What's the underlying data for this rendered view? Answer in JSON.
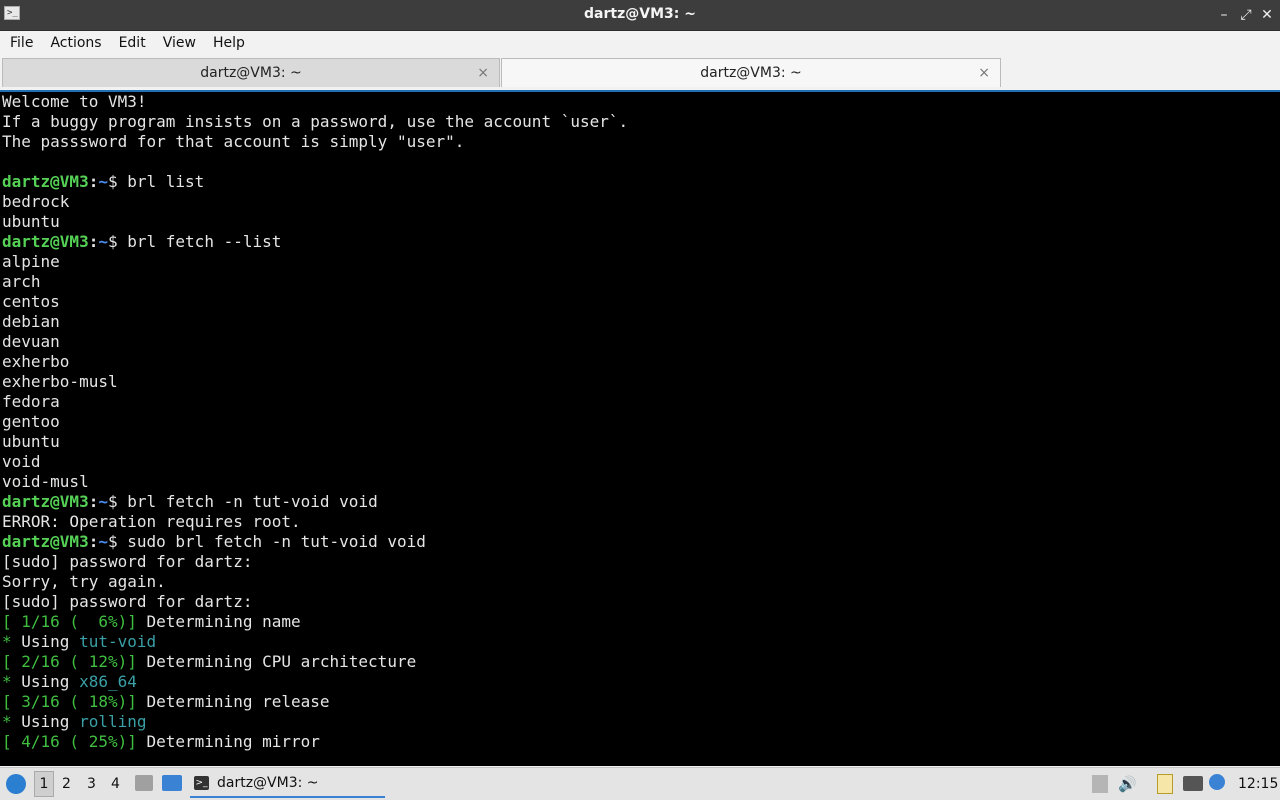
{
  "window": {
    "title": "dartz@VM3: ~"
  },
  "menu": [
    "File",
    "Actions",
    "Edit",
    "View",
    "Help"
  ],
  "tabs": [
    {
      "label": "dartz@VM3: ~",
      "close": "×"
    },
    {
      "label": "dartz@VM3: ~",
      "close": "×"
    }
  ],
  "terminal": {
    "prompt_user": "dartz@VM3",
    "prompt_path": "~",
    "welcome": [
      "Welcome to VM3!",
      "If a buggy program insists on a password, use the account `user`.",
      "The passsword for that account is simply \"user\"."
    ],
    "cmd1": "brl list",
    "strata": [
      "bedrock",
      "ubuntu"
    ],
    "cmd2": "brl fetch --list",
    "fetch_list": [
      "alpine",
      "arch",
      "centos",
      "debian",
      "devuan",
      "exherbo",
      "exherbo-musl",
      "fedora",
      "gentoo",
      "ubuntu",
      "void",
      "void-musl"
    ],
    "cmd3": "brl fetch -n tut-void void",
    "error": "ERROR: Operation requires root.",
    "cmd4": "sudo brl fetch -n tut-void void",
    "sudo_prompt": "[sudo] password for dartz:",
    "sorry": "Sorry, try again.",
    "progress": [
      {
        "step": "[ 1/16 (  6%)]",
        "text": " Determining name"
      },
      {
        "step": "[ 2/16 ( 12%)]",
        "text": " Determining CPU architecture"
      },
      {
        "step": "[ 3/16 ( 18%)]",
        "text": " Determining release"
      },
      {
        "step": "[ 4/16 ( 25%)]",
        "text": " Determining mirror"
      }
    ],
    "using_prefix": "* Using ",
    "using": [
      "tut-void",
      "x86_64",
      "rolling"
    ]
  },
  "taskbar": {
    "workspaces": [
      "1",
      "2",
      "3",
      "4"
    ],
    "task_label": "dartz@VM3: ~",
    "clock": "12:15"
  },
  "colors": {
    "accent": "#1e6fb3",
    "prompt_user": "#55d155",
    "prompt_path": "#4b8ef0",
    "output_cyan": "#3a9fa6",
    "error": "#e33b3b"
  }
}
